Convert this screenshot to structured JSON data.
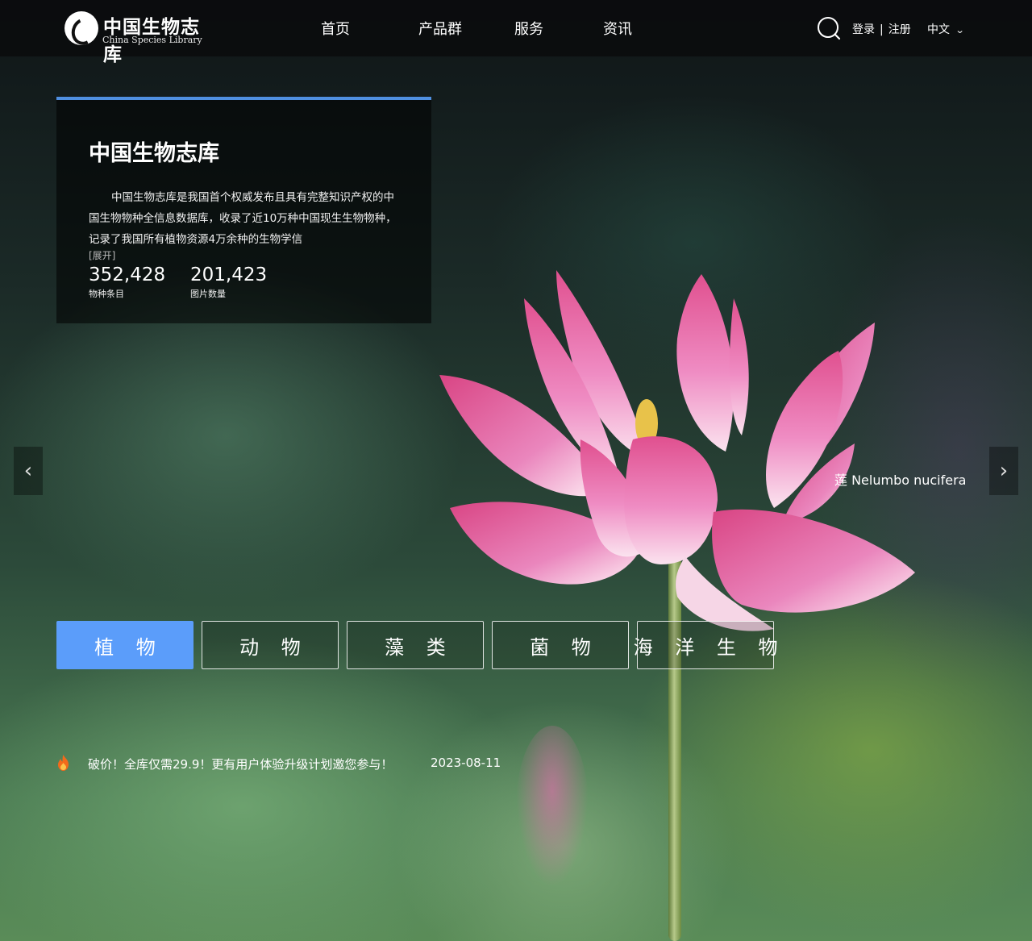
{
  "brand": {
    "name_cn": "中国生物志库",
    "name_en": "China Species Library"
  },
  "nav": {
    "items": [
      "首页",
      "产品群",
      "服务",
      "资讯"
    ]
  },
  "auth": {
    "login": "登录",
    "separator": "|",
    "register": "注册"
  },
  "language": {
    "current": "中文"
  },
  "intro": {
    "title": "中国生物志库",
    "description": "中国生物志库是我国首个权威发布且具有完整知识产权的中国生物物种全信息数据库，收录了近10万种中国现生生物物种，记录了我国所有植物资源4万余种的生物学信",
    "expand": "[展开]",
    "stats": [
      {
        "value": "352,428",
        "label": "物种条目"
      },
      {
        "value": "201,423",
        "label": "图片数量"
      }
    ]
  },
  "slider": {
    "prev": "‹",
    "next": "›",
    "caption": "莲 Nelumbo nucifera"
  },
  "categories": {
    "items": [
      "植 物",
      "动 物",
      "藻 类",
      "菌 物",
      "海 洋 生 物"
    ],
    "active_index": 0
  },
  "news": {
    "text": "破价！全库仅需29.9！更有用户体验升级计划邀您参与！",
    "date": "2023-08-11"
  },
  "colors": {
    "accent": "#5b9dfa",
    "intro_border": "#4f8fe0",
    "fire": "#f26a1b"
  }
}
